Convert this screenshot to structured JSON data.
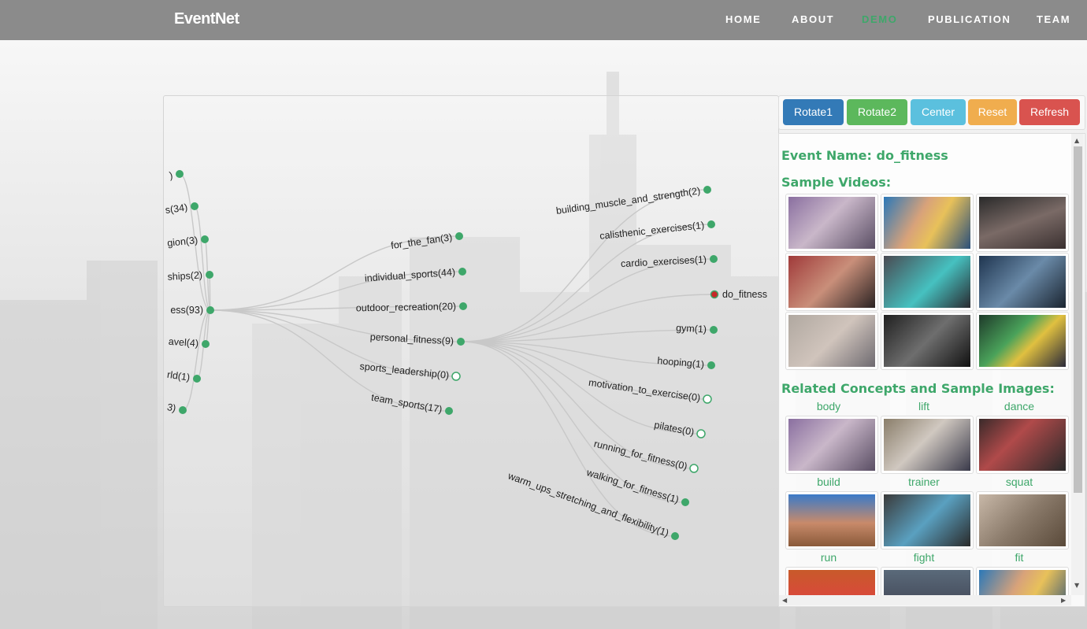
{
  "navbar": {
    "brand": "EventNet",
    "links": [
      "HOME",
      "ABOUT",
      "DEMO",
      "PUBLICATION",
      "TEAM"
    ],
    "active": "DEMO",
    "active_color": "#3ea76a"
  },
  "graph": {
    "left_labels": [
      ")",
      "s(34)",
      "gion(3)",
      "ships(2)",
      "ess(93)",
      "avel(4)",
      "rld(1)",
      "3)"
    ],
    "middle_labels": [
      "for_the_fan(3)",
      "individual_sports(44)",
      "outdoor_recreation(20)",
      "personal_fitness(9)",
      "sports_leadership(0)",
      "team_sports(17)"
    ],
    "right_labels": [
      "building_muscle_and_strength(2)",
      "calisthenic_exercises(1)",
      "cardio_exercises(1)",
      "do_fitness",
      "gym(1)",
      "hooping(1)",
      "motivation_to_exercise(0)",
      "pilates(0)",
      "running_for_fitness(0)",
      "walking_for_fitness(1)",
      "warm_ups_stretching_and_flexibility(1)"
    ],
    "colors": {
      "node": "#3ea76a",
      "selected": "#c62828",
      "edge": "#c8c8c8"
    }
  },
  "buttons": [
    {
      "label": "Rotate1",
      "color": "#337ab7"
    },
    {
      "label": "Rotate2",
      "color": "#5cb85c"
    },
    {
      "label": "Center",
      "color": "#5bc0de"
    },
    {
      "label": "Reset",
      "color": "#f0ad4e"
    },
    {
      "label": "Refresh",
      "color": "#d9534f"
    }
  ],
  "info": {
    "event_name": "Event Name: do_fitness",
    "sample_videos_heading": "Sample Videos:",
    "related_heading": "Related Concepts and Sample Images:",
    "concepts": [
      "body",
      "lift",
      "dance",
      "build",
      "trainer",
      "squat",
      "run",
      "fight",
      "fit"
    ]
  }
}
